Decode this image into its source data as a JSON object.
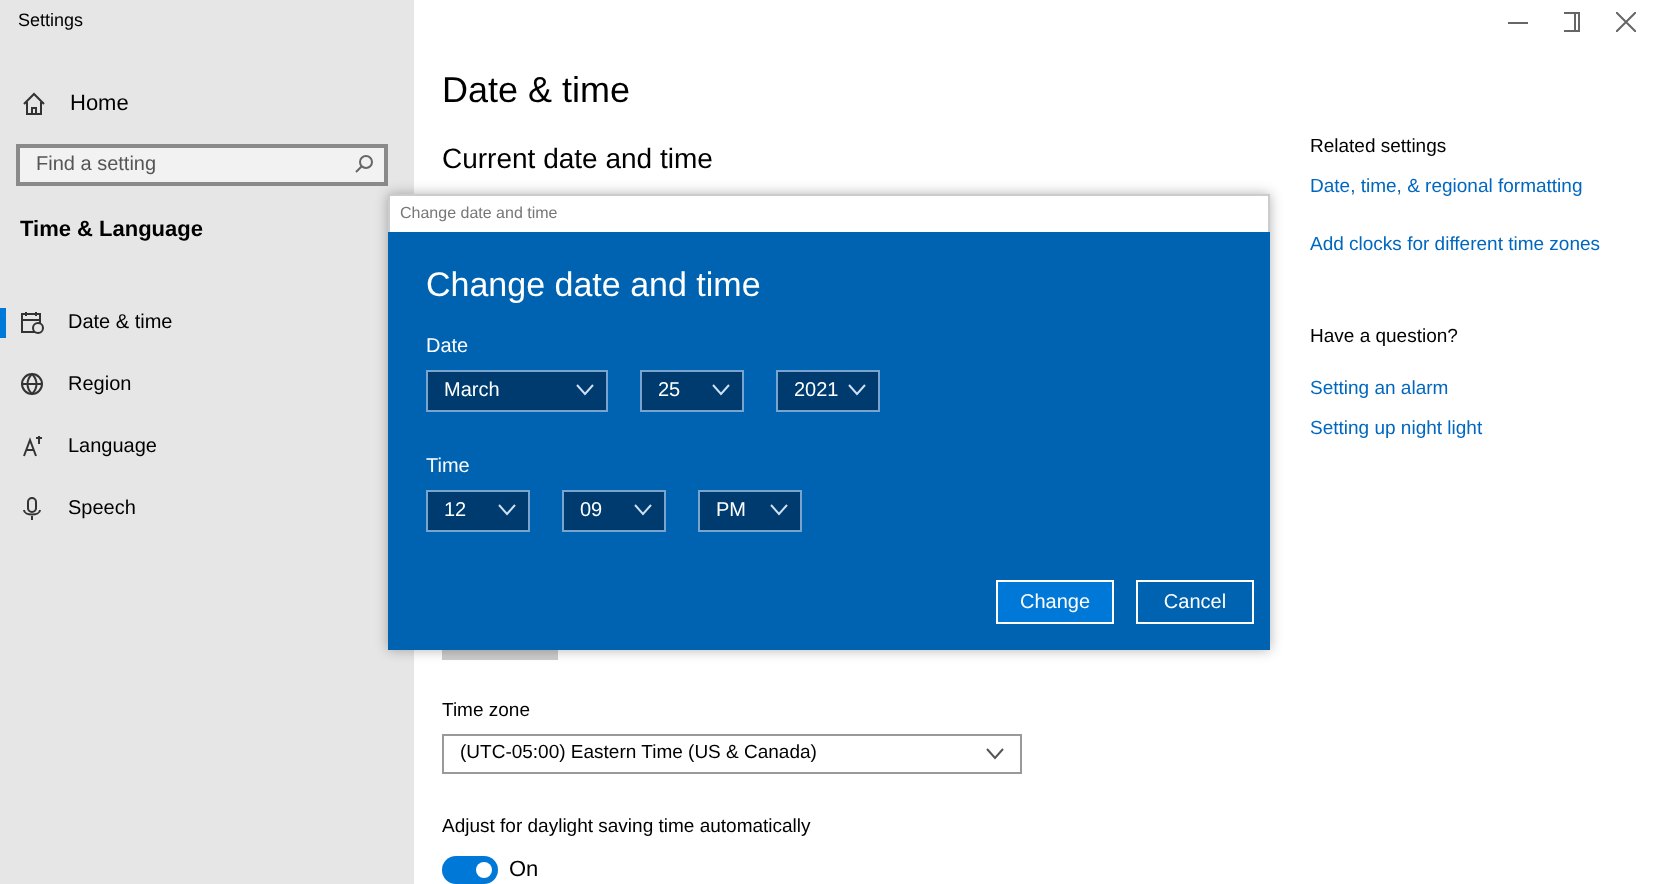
{
  "window": {
    "title": "Settings"
  },
  "sidebar": {
    "home": "Home",
    "search": {
      "placeholder": "Find a setting"
    },
    "section": "Time & Language",
    "items": [
      {
        "label": "Date & time",
        "kind": "calendar",
        "selected": true
      },
      {
        "label": "Region",
        "kind": "globe",
        "selected": false
      },
      {
        "label": "Language",
        "kind": "language",
        "selected": false
      },
      {
        "label": "Speech",
        "kind": "mic",
        "selected": false
      }
    ]
  },
  "main": {
    "title": "Date & time",
    "subtitle": "Current date and time",
    "time_zone": {
      "label": "Time zone",
      "value": "(UTC-05:00) Eastern Time (US & Canada)"
    },
    "daylight": {
      "label": "Adjust for daylight saving time automatically",
      "on": true,
      "state_text": "On"
    }
  },
  "related": {
    "heading": "Related settings",
    "links": [
      "Date, time, & regional formatting",
      "Add clocks for different time zones"
    ]
  },
  "question": {
    "heading": "Have a question?",
    "links": [
      "Setting an alarm",
      "Setting up night light"
    ]
  },
  "dialog": {
    "window_title": "Change date and time",
    "heading": "Change date and time",
    "date_label": "Date",
    "date_fields": [
      "March",
      "25",
      "2021"
    ],
    "time_label": "Time",
    "time_fields": [
      "12",
      "09",
      "PM"
    ],
    "buttons": [
      {
        "label": "Change",
        "primary": true
      },
      {
        "label": "Cancel",
        "primary": false
      }
    ]
  }
}
